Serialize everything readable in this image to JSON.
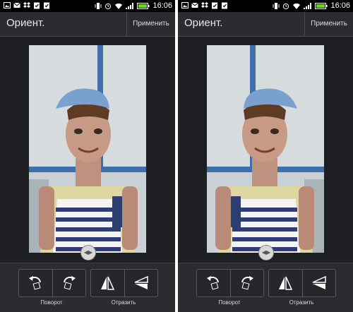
{
  "status_bar": {
    "time": "16:06",
    "icons": [
      "image-icon",
      "mail-icon",
      "dropbox-icon",
      "clipboard-check-icon",
      "task-icon",
      "vibrate-icon",
      "alarm-icon",
      "wifi-icon",
      "signal-icon",
      "battery-icon"
    ]
  },
  "screens": [
    {
      "title": "Ориент.",
      "apply_label": "Применить",
      "rotate_label": "Поворот",
      "flip_label": "Отразить",
      "mirrored": false
    },
    {
      "title": "Ориент.",
      "apply_label": "Применить",
      "rotate_label": "Поворот",
      "flip_label": "Отразить",
      "mirrored": true
    }
  ],
  "colors": {
    "screen_background": "#1d1f22",
    "bar_background": "#2a2c30",
    "accent_cap": "#6f95c8"
  }
}
